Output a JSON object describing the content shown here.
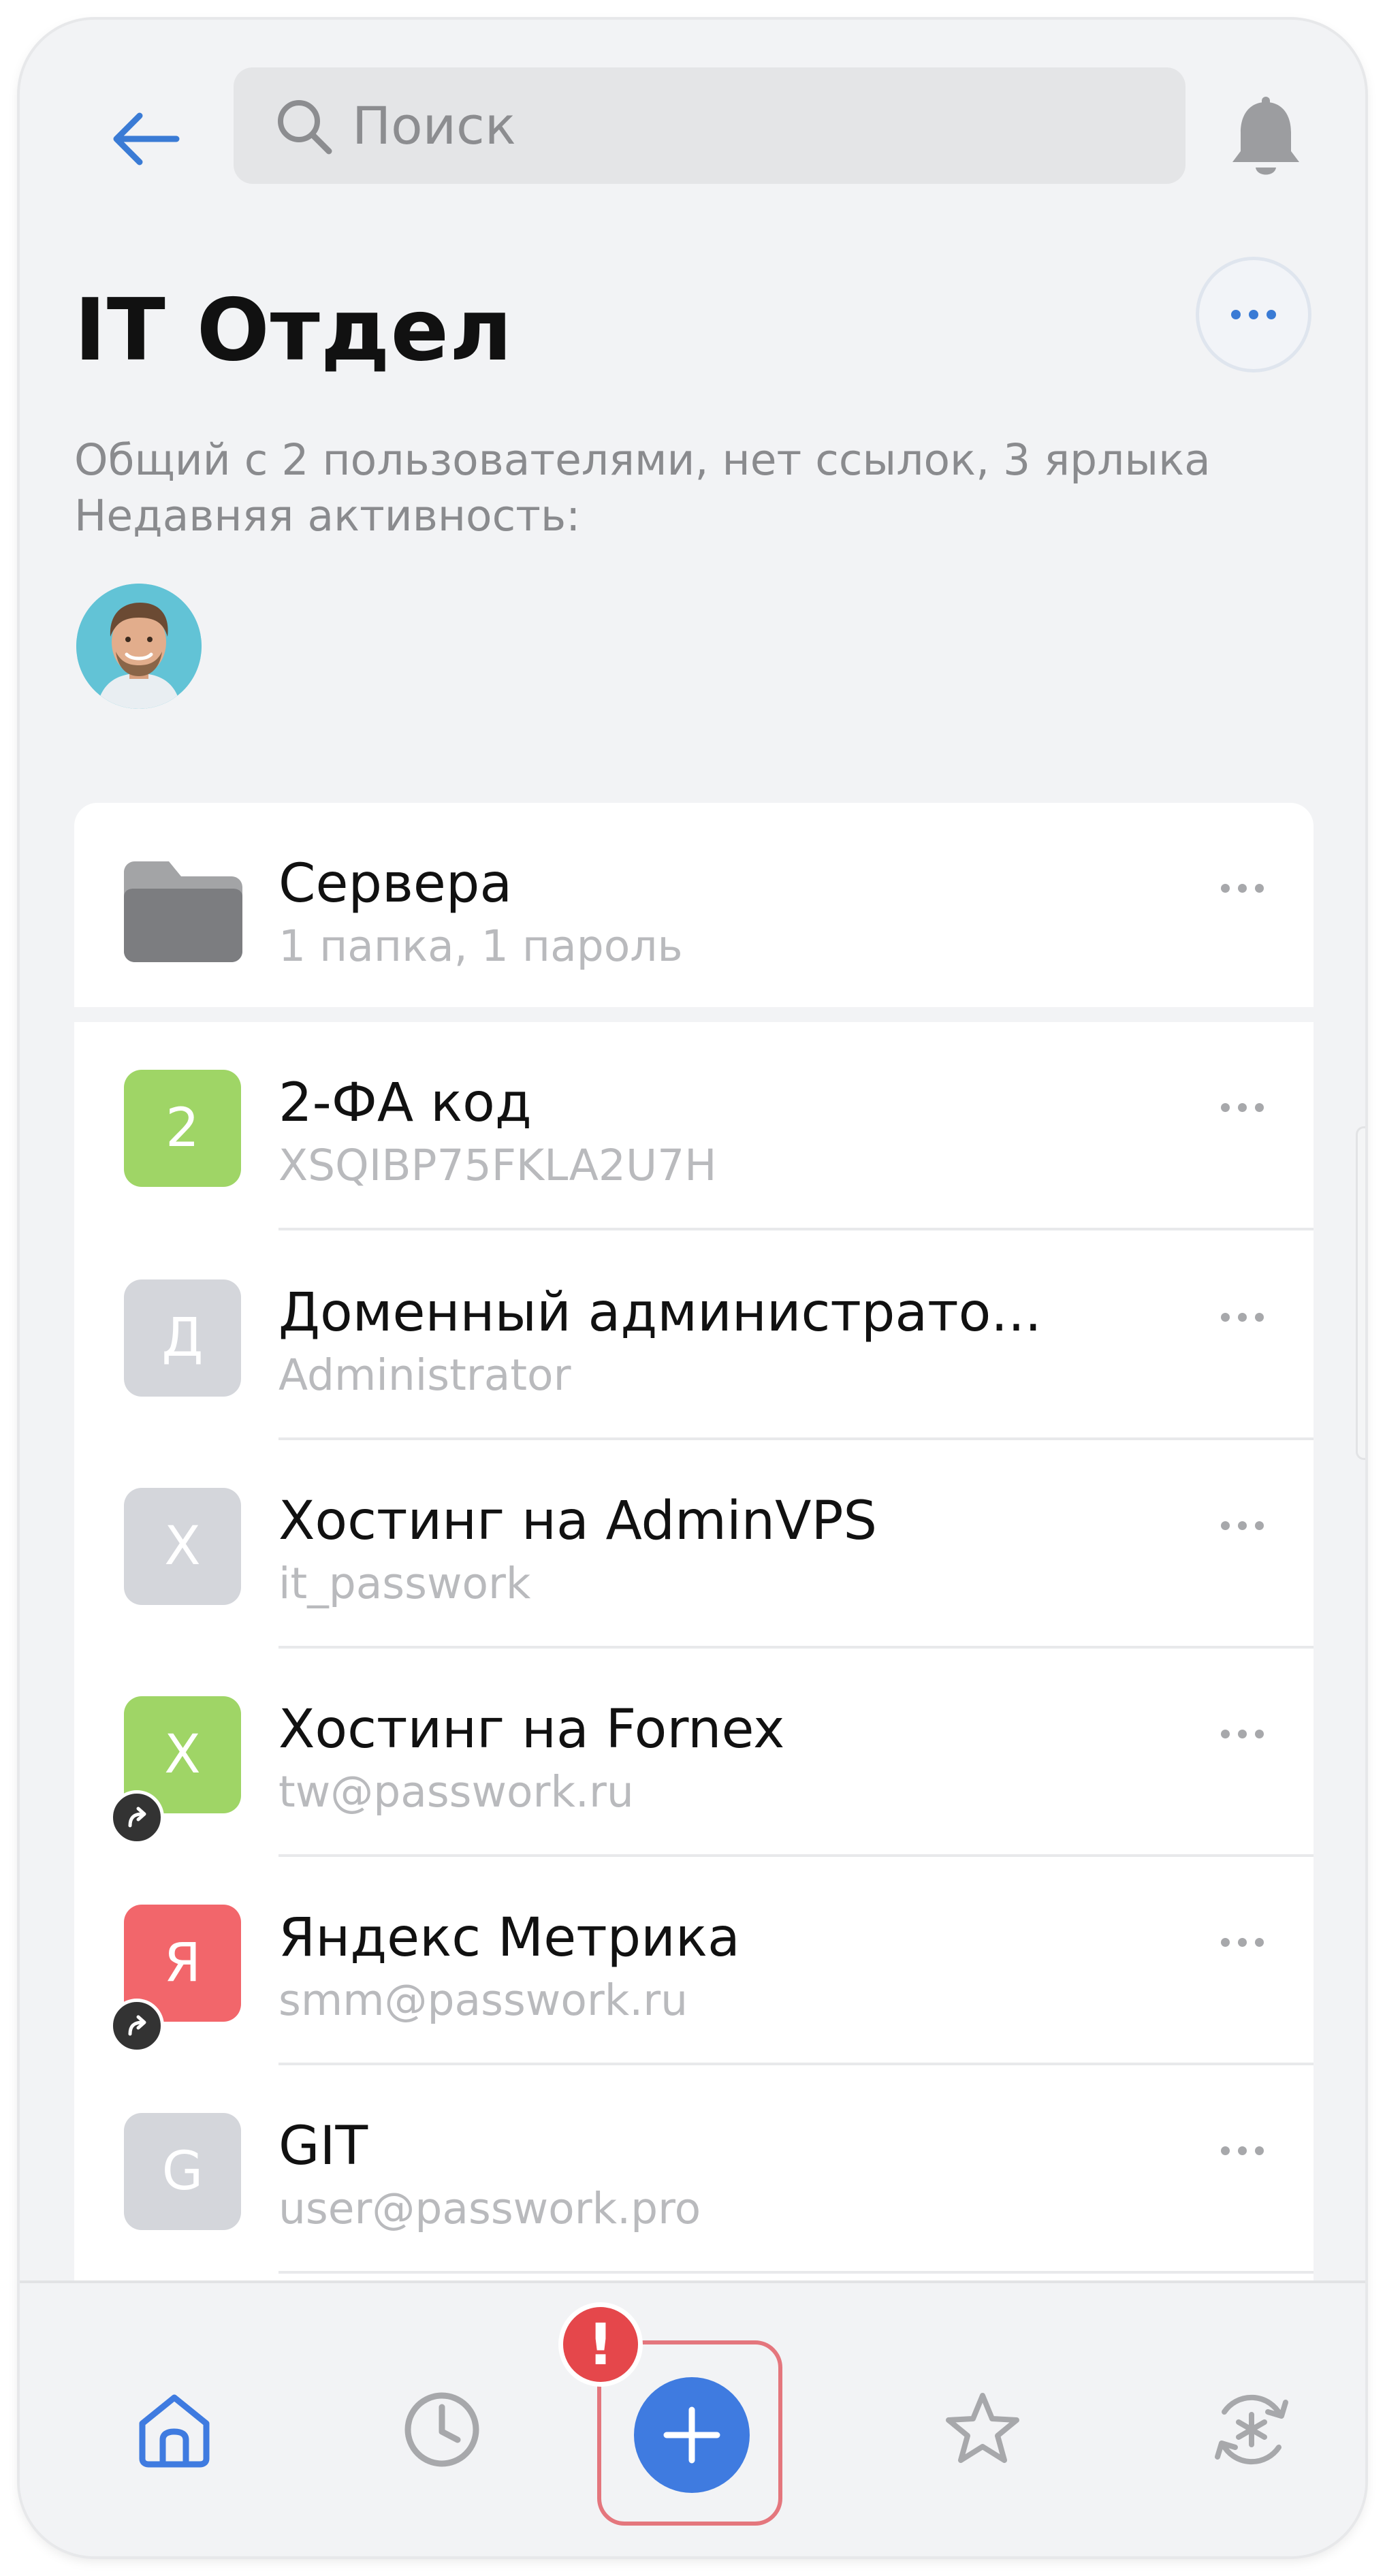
{
  "header": {
    "search_placeholder": "Поиск",
    "title": "IT Отдел",
    "subtitle_line1": "Общий с 2 пользователями, нет ссылок, 3 ярлыка",
    "subtitle_line2": "Недавняя активность:"
  },
  "icons": {
    "back": "arrow-left-icon",
    "search": "search-icon",
    "notifications": "bell-icon",
    "more": "more-horizontal-icon",
    "folder": "folder-icon",
    "shared": "share-arrow-icon",
    "nav_home": "home-icon",
    "nav_recent": "clock-icon",
    "nav_add": "plus-icon",
    "nav_favorites": "star-icon",
    "nav_generator": "password-generator-icon"
  },
  "folder": {
    "title": "Сервера",
    "subtitle": "1 папка, 1 пароль"
  },
  "items": [
    {
      "letter": "2",
      "title": "2-ФА код",
      "subtitle": "XSQIBP75FKLA2U7H",
      "color": "#9fd566",
      "shared": false
    },
    {
      "letter": "Д",
      "title": "Доменный администрато...",
      "subtitle": "Administrator",
      "color": "#d4d6db",
      "shared": false
    },
    {
      "letter": "Х",
      "title": "Хостинг на AdminVPS",
      "subtitle": "it_passwork",
      "color": "#d4d6db",
      "shared": false
    },
    {
      "letter": "Х",
      "title": "Хостинг на Fornex",
      "subtitle": "tw@passwork.ru",
      "color": "#9fd566",
      "shared": true
    },
    {
      "letter": "Я",
      "title": "Яндекс Метрика",
      "subtitle": "smm@passwork.ru",
      "color": "#f2666b",
      "shared": true
    },
    {
      "letter": "G",
      "title": "GIT",
      "subtitle": "user@passwork.pro",
      "color": "#d4d6db",
      "shared": false
    }
  ],
  "bottom_nav": {
    "alert_badge": "!"
  },
  "colors": {
    "accent": "#3f7be0",
    "alert": "#e5474b",
    "highlight_outline": "#e4767d"
  }
}
